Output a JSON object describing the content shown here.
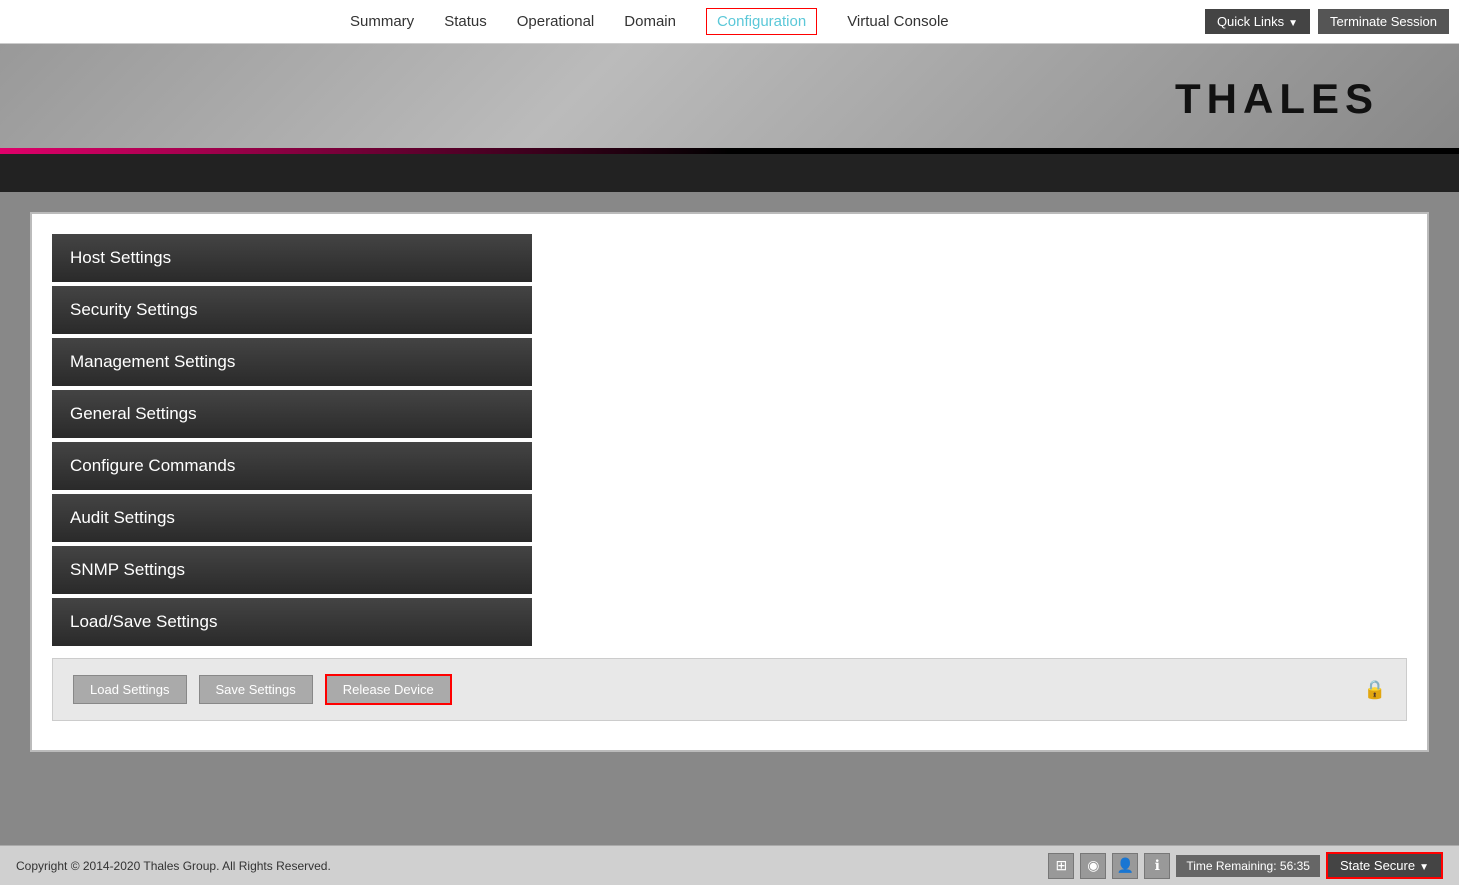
{
  "nav": {
    "links": [
      {
        "label": "Summary",
        "active": false
      },
      {
        "label": "Status",
        "active": false
      },
      {
        "label": "Operational",
        "active": false
      },
      {
        "label": "Domain",
        "active": false
      },
      {
        "label": "Configuration",
        "active": true
      },
      {
        "label": "Virtual Console",
        "active": false
      }
    ],
    "quick_links_label": "Quick Links",
    "terminate_label": "Terminate Session"
  },
  "header": {
    "logo": "THALES"
  },
  "sidebar": {
    "items": [
      {
        "label": "Host Settings"
      },
      {
        "label": "Security Settings"
      },
      {
        "label": "Management Settings"
      },
      {
        "label": "General Settings"
      },
      {
        "label": "Configure Commands"
      },
      {
        "label": "Audit Settings"
      },
      {
        "label": "SNMP Settings"
      },
      {
        "label": "Load/Save Settings"
      }
    ]
  },
  "actions": {
    "load_settings": "Load Settings",
    "save_settings": "Save Settings",
    "release_device": "Release Device"
  },
  "footer": {
    "copyright": "Copyright © 2014-2020 Thales Group. All Rights Reserved.",
    "time_remaining": "Time Remaining: 56:35",
    "state_secure": "State Secure"
  }
}
